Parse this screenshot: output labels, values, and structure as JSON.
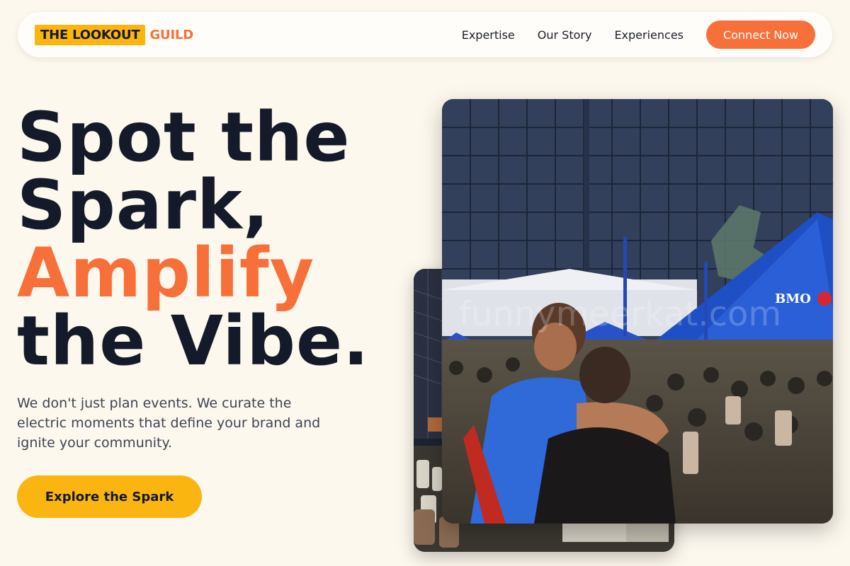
{
  "brand": {
    "name": "THE LOOKOUT",
    "accent": "GUILD",
    "colors": {
      "primary": "#fbb511",
      "accent": "#f7703a",
      "dark": "#141a29",
      "background": "#fdf8ee"
    }
  },
  "nav": {
    "links": [
      "Expertise",
      "Our Story",
      "Experiences"
    ],
    "cta": "Connect Now"
  },
  "hero": {
    "title_line1": "Spot the",
    "title_line2": "Spark,",
    "title_accent": "Amplify",
    "title_line4": "the Vibe.",
    "subtitle": "We don't just plan events. We curate the electric moments that define your brand and ignite your community.",
    "cta": "Explore the Spark"
  },
  "images": {
    "front_watermark": "funnymeerkat.com",
    "front_tent_text": "BMO"
  }
}
